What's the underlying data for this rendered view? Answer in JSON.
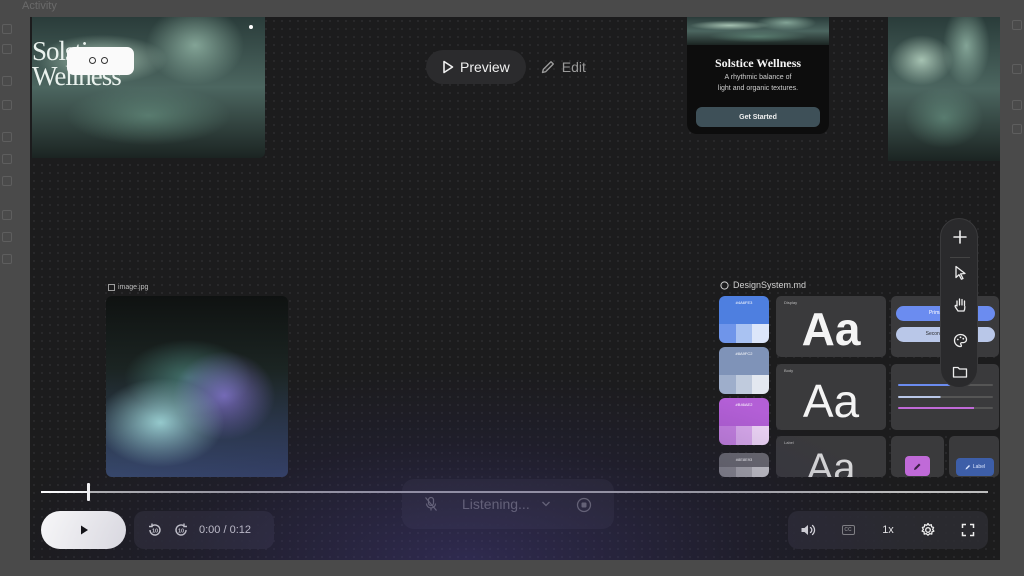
{
  "backdrop": {
    "title": "Activity"
  },
  "canvas": {
    "hero_card": {
      "title_line1": "Solstice",
      "title_line2": "Wellness"
    },
    "mode_tabs": {
      "preview_label": "Preview",
      "edit_label": "Edit"
    },
    "phone_card": {
      "title": "Solstice Wellness",
      "subtitle_line1": "A rhythmic balance of",
      "subtitle_line2": "light and organic textures.",
      "cta_label": "Get Started"
    },
    "image_asset": {
      "filename": "image.jpg"
    },
    "design_system": {
      "filename": "DesignSystem.md",
      "swatches": [
        {
          "hex": "#4A6FE3",
          "color": "#4e7fe0",
          "tones": [
            "#6f95ea",
            "#a9c2f2",
            "#dce6fa"
          ]
        },
        {
          "hex": "#8A9FC2",
          "color": "#7f93b8",
          "tones": [
            "#9eaecb",
            "#c0cbdd",
            "#e3e8f0"
          ]
        },
        {
          "hex": "#B46AE2",
          "color": "#b35fd6",
          "tones": [
            "#c47fe0",
            "#d9a9ec",
            "#efd6f7"
          ]
        },
        {
          "hex": "#8E8E93",
          "color": "#6b6b70",
          "tones": [
            "#8a8a8f",
            "#a9a9ad",
            "#c9c9cc"
          ]
        }
      ],
      "type_tiles": [
        {
          "label": "Display",
          "sample": "Aa"
        },
        {
          "label": "Body",
          "sample": "Aa"
        },
        {
          "label": "Label",
          "sample": "Aa"
        }
      ],
      "buttons": {
        "primary": "Primary Button",
        "secondary": "Secondary Button",
        "small": "Label"
      },
      "colors": {
        "primary": "#6b8cf0",
        "secondary": "#b9c7e8",
        "accent": "#c06ad8"
      }
    },
    "toolbar": [
      "plus-icon",
      "cursor-icon",
      "hand-icon",
      "palette-icon",
      "folder-icon"
    ]
  },
  "player": {
    "progress": 0.05,
    "listening_label": "Listening...",
    "time_current": "0:00",
    "time_total": "0:12",
    "time_separator": " / ",
    "speed_label": "1x",
    "cc_label": "CC"
  }
}
